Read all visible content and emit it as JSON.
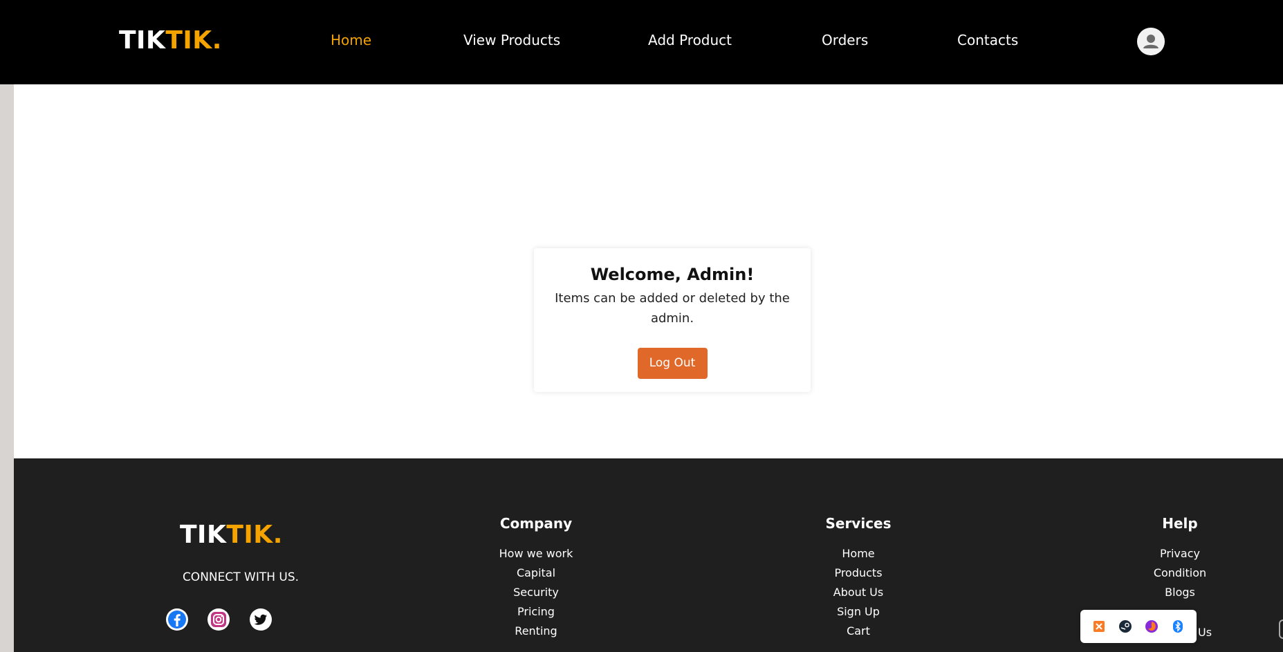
{
  "brand": {
    "part1": "TIK",
    "part2": "TIK."
  },
  "nav": {
    "items": [
      {
        "label": "Home",
        "active": true
      },
      {
        "label": "View Products",
        "active": false
      },
      {
        "label": "Add Product",
        "active": false
      },
      {
        "label": "Orders",
        "active": false
      },
      {
        "label": "Contacts",
        "active": false
      }
    ],
    "avatar_icon": "user-avatar-icon"
  },
  "card": {
    "title": "Welcome, Admin!",
    "text": "Items can be added or deleted by the admin.",
    "button_label": "Log Out"
  },
  "footer": {
    "connect_label": "CONNECT WITH US.",
    "social": [
      "facebook-icon",
      "instagram-icon",
      "twitter-icon"
    ],
    "columns": [
      {
        "title": "Company",
        "items": [
          "How we work",
          "Capital",
          "Security",
          "Pricing",
          "Renting"
        ]
      },
      {
        "title": "Services",
        "items": [
          "Home",
          "Products",
          "About Us",
          "Sign Up",
          "Cart"
        ]
      },
      {
        "title": "Help",
        "items": [
          "Privacy",
          "Condition",
          "Blogs"
        ]
      }
    ],
    "partial_text": "Us"
  },
  "tray": {
    "icons": [
      "xampp-icon",
      "steam-icon",
      "firefox-icon",
      "bluetooth-icon"
    ]
  },
  "colors": {
    "accent": "#f5a300",
    "button": "#e0692a",
    "header_bg": "#000000",
    "footer_bg": "#1f1f1f"
  }
}
